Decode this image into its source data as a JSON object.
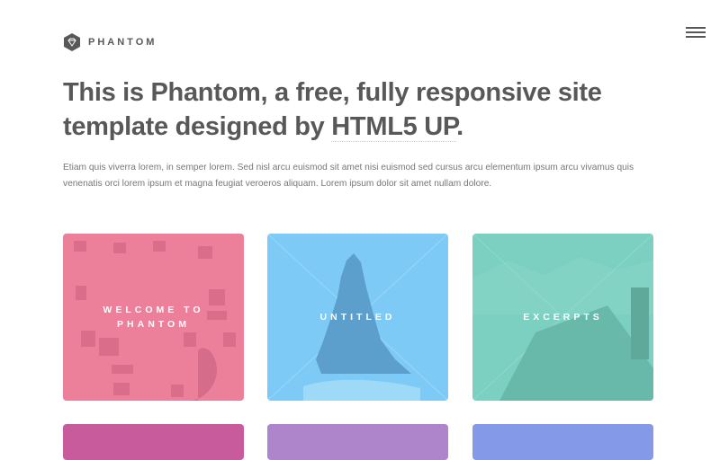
{
  "site": {
    "name": "PHANTOM"
  },
  "header": {
    "logo_icon": "diamond-hexagon-icon",
    "menu_icon": "hamburger-menu-icon"
  },
  "headline": {
    "text": "This is Phantom, a free, fully responsive site template designed by ",
    "link": "HTML5 UP",
    "suffix": "."
  },
  "intro": "Etiam quis viverra lorem, in semper lorem. Sed nisl arcu euismod sit amet nisi euismod sed cursus arcu elementum ipsum arcu vivamus quis venenatis orci lorem ipsum et magna feugiat veroeros aliquam. Lorem ipsum dolor sit amet nullam dolore.",
  "tiles": [
    {
      "title": "WELCOME TO PHANTOM",
      "color": "#f2849e"
    },
    {
      "title": "UNTITLED",
      "color": "#7ecaf6"
    },
    {
      "title": "EXCERPTS",
      "color": "#7bd0c1"
    },
    {
      "title": "",
      "color": "#c75b9b"
    },
    {
      "title": "",
      "color": "#ae85ca"
    },
    {
      "title": "",
      "color": "#8499e7"
    }
  ]
}
